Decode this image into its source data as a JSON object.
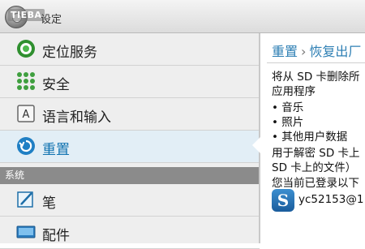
{
  "topbar": {
    "title": "设定",
    "watermark": "TIEBA"
  },
  "sidebar": {
    "section_label": "系统",
    "items": [
      {
        "label": "定位服务",
        "icon": "location-icon"
      },
      {
        "label": "安全",
        "icon": "security-grid-icon"
      },
      {
        "label": "语言和输入",
        "icon": "language-icon"
      },
      {
        "label": "重置",
        "icon": "reset-icon",
        "active": true
      },
      {
        "label": "笔",
        "icon": "pen-icon"
      },
      {
        "label": "配件",
        "icon": "accessory-icon"
      }
    ]
  },
  "detail": {
    "breadcrumb_parent": "重置",
    "breadcrumb_separator": "›",
    "breadcrumb_current": "恢复出厂",
    "line1": "将从 SD 卡删除所",
    "line2": "应用程序",
    "bullets": [
      "音乐",
      "照片",
      "其他用户数据"
    ],
    "line3": "用于解密 SD 卡上",
    "line4": "SD 卡上的文件）",
    "line5": "您当前已登录以下",
    "account_text": "yc52153@1",
    "account_icon_letter": "S"
  },
  "colors": {
    "accent": "#0f72b0",
    "section_header": "#8b8b8b",
    "active_row": "#e2eef6"
  }
}
